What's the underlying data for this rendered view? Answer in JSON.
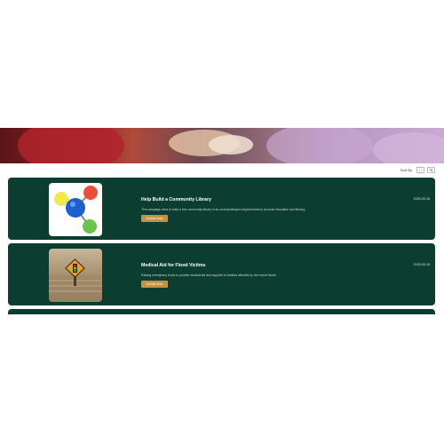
{
  "sort": {
    "label": "Sort By",
    "asc_icon": "↓↑",
    "filter_icon": "⇅"
  },
  "campaigns": [
    {
      "title": "Help Build a Community Library",
      "description": "This campaign aims to build a free community library in an underprivileged neighborhood to promote education and literacy.",
      "date": "2025-09-18",
      "button": "Donate Now",
      "image_icon": "molecule-icon"
    },
    {
      "title": "Medical Aid for Flood Victims",
      "description": "Raising emergency funds to provide medical aid and supplies to families affected by the recent floods.",
      "date": "2025-09-15",
      "button": "Donate Now",
      "image_icon": "flood-road-sign-icon"
    }
  ],
  "colors": {
    "card_bg": "#0c3d31",
    "button_bg": "#c8913c"
  }
}
